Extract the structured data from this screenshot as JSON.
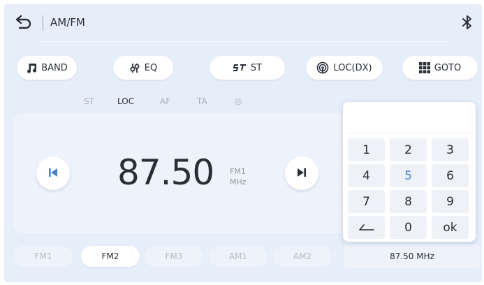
{
  "header": {
    "title": "AM/FM",
    "back_icon": "back-arrow-icon",
    "bt_icon": "bluetooth-icon"
  },
  "functions": [
    {
      "label": "BAND",
      "icon": "music-note-icon"
    },
    {
      "label": "EQ",
      "icon": "eq-sliders-icon"
    },
    {
      "label": "ST",
      "icon": "stereo-icon"
    },
    {
      "label": "LOC(DX)",
      "icon": "radio-signal-icon"
    },
    {
      "label": "GOTO",
      "icon": "grid-icon"
    }
  ],
  "flags": [
    {
      "label": "ST",
      "active": false
    },
    {
      "label": "LOC",
      "active": true
    },
    {
      "label": "AF",
      "active": false
    },
    {
      "label": "TA",
      "active": false
    },
    {
      "label": "◎",
      "active": false
    }
  ],
  "tuner": {
    "frequency": "87.50",
    "band": "FM1",
    "unit": "MHz"
  },
  "presets": [
    {
      "label": "FM1",
      "active": false
    },
    {
      "label": "FM2",
      "active": true
    },
    {
      "label": "FM3",
      "active": false
    },
    {
      "label": "AM1",
      "active": false
    },
    {
      "label": "AM2",
      "active": false
    }
  ],
  "readout": "87.50 MHz",
  "keypad": {
    "display": "",
    "keys": [
      "1",
      "2",
      "3",
      "4",
      "5",
      "6",
      "7",
      "8",
      "9",
      "←",
      "0",
      "ok"
    ],
    "highlighted": "5"
  },
  "colors": {
    "accent": "#3f86d8",
    "background": "#e6eefa"
  }
}
